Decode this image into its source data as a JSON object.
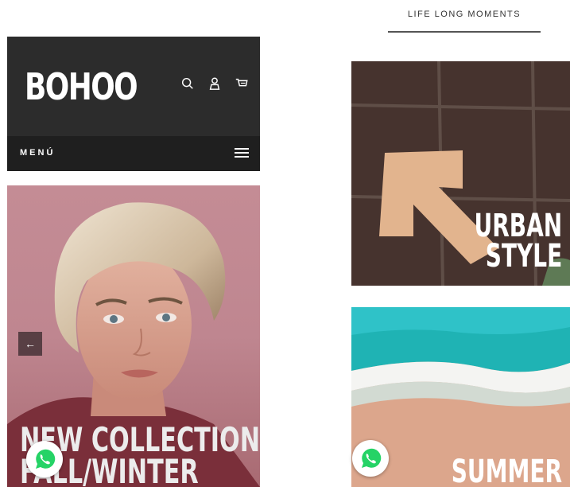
{
  "left_screen": {
    "logo": "BOHOO",
    "menu_label": "MENÚ",
    "hero": {
      "title_line1": "NEW COLLECTION",
      "title_line2": "FALL/WINTER",
      "prev_symbol": "←"
    }
  },
  "right_screen": {
    "section_title": "LIFE LONG MOMENTS",
    "cards": [
      {
        "caption_line1": "URBAN",
        "caption_line2": "STYLE"
      },
      {
        "caption_line1": "SUMMER"
      }
    ]
  },
  "colors": {
    "header_bg": "#2c2c2c",
    "menu_bar_bg": "#1f1f1f",
    "hero_bg": "#c48c95",
    "whatsapp_green": "#25d366"
  },
  "icons": [
    "search-icon",
    "user-icon",
    "cart-icon",
    "hamburger-icon",
    "arrow-left-icon",
    "whatsapp-icon"
  ]
}
